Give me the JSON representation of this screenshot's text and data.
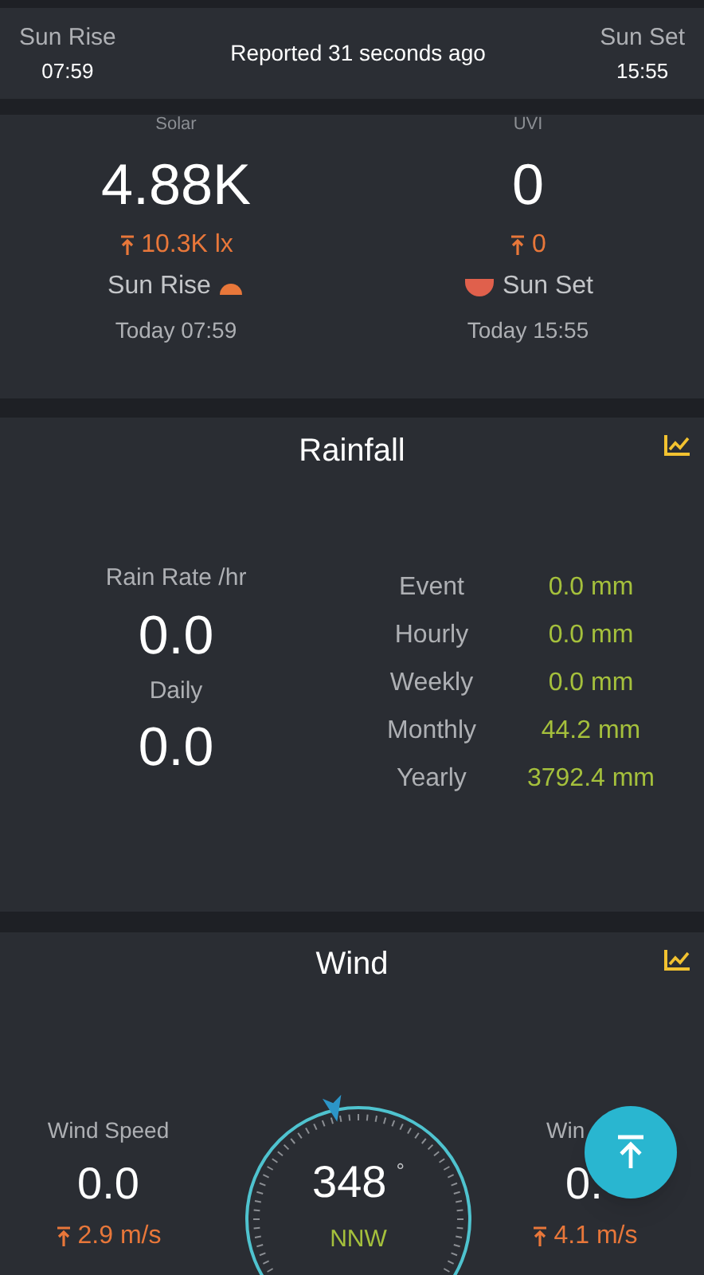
{
  "header": {
    "sunrise_label": "Sun Rise",
    "sunrise_time": "07:59",
    "reported": "Reported 31 seconds ago",
    "sunset_label": "Sun Set",
    "sunset_time": "15:55"
  },
  "solar": {
    "columns": [
      {
        "label": "Solar",
        "value": "4.88K",
        "max": "10.3K lx",
        "event": "Sun Rise",
        "kind": "rise",
        "when": "Today 07:59"
      },
      {
        "label": "UVI",
        "value": "0",
        "max": "0",
        "event": "Sun Set",
        "kind": "set",
        "when": "Today 15:55"
      }
    ]
  },
  "rainfall": {
    "title": "Rainfall",
    "rate_label": "Rain Rate /hr",
    "rate": "0.0",
    "daily_label": "Daily",
    "daily": "0.0",
    "rows": [
      {
        "label": "Event",
        "value": "0.0 mm"
      },
      {
        "label": "Hourly",
        "value": "0.0 mm"
      },
      {
        "label": "Weekly",
        "value": "0.0 mm"
      },
      {
        "label": "Monthly",
        "value": "44.2 mm"
      },
      {
        "label": "Yearly",
        "value": "3792.4 mm"
      }
    ]
  },
  "wind": {
    "title": "Wind",
    "speed_label": "Wind Speed",
    "speed": "0.0",
    "speed_max": "2.9 m/s",
    "direction": "348",
    "degree_sign": "°",
    "compass": "NNW",
    "gust_label": "Win",
    "gust": "0.",
    "gust_max": "4.1 m/s"
  }
}
